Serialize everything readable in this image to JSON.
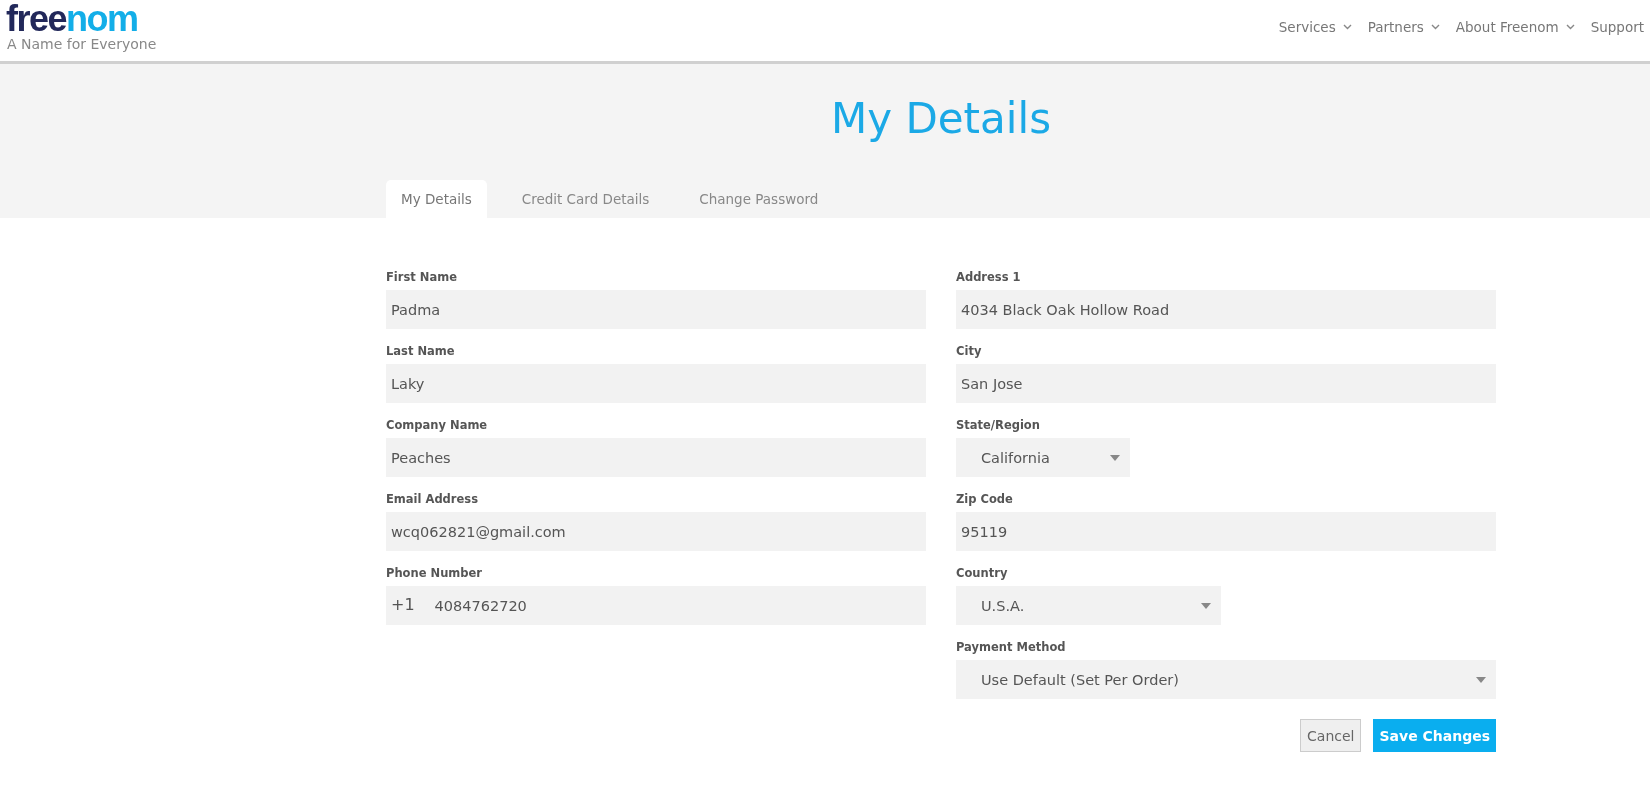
{
  "header": {
    "logo": {
      "first": "free",
      "second": "nom"
    },
    "tagline": "A Name for Everyone",
    "nav": [
      {
        "label": "Services",
        "dropdown": true
      },
      {
        "label": "Partners",
        "dropdown": true
      },
      {
        "label": "About Freenom",
        "dropdown": true
      },
      {
        "label": "Support",
        "dropdown": false
      }
    ]
  },
  "page_title": "My Details",
  "tabs": [
    {
      "label": "My Details",
      "selected": true
    },
    {
      "label": "Credit Card Details",
      "selected": false
    },
    {
      "label": "Change Password",
      "selected": false
    }
  ],
  "left_fields": [
    {
      "kind": "text",
      "label": "First Name",
      "value": "Padma"
    },
    {
      "kind": "text",
      "label": "Last Name",
      "value": "Laky"
    },
    {
      "kind": "text",
      "label": "Company Name",
      "value": "Peaches"
    },
    {
      "kind": "text",
      "label": "Email Address",
      "value": "wcq062821@gmail.com"
    },
    {
      "kind": "phone",
      "label": "Phone Number",
      "prefix": "+1",
      "value": "4084762720"
    }
  ],
  "right_fields": [
    {
      "kind": "text",
      "label": "Address 1",
      "value": "4034  Black Oak Hollow Road"
    },
    {
      "kind": "text",
      "label": "City",
      "value": "San Jose"
    },
    {
      "kind": "select",
      "label": "State/Region",
      "value": "California"
    },
    {
      "kind": "text",
      "label": "Zip Code",
      "value": "95119"
    },
    {
      "kind": "select",
      "label": "Country",
      "value": "U.S.A."
    },
    {
      "kind": "select",
      "label": "Payment Method",
      "value": "Use Default (Set Per Order)"
    }
  ],
  "buttons": [
    {
      "kind": "secondary",
      "label": "Cancel"
    },
    {
      "kind": "primary",
      "label": "Save Changes"
    }
  ]
}
